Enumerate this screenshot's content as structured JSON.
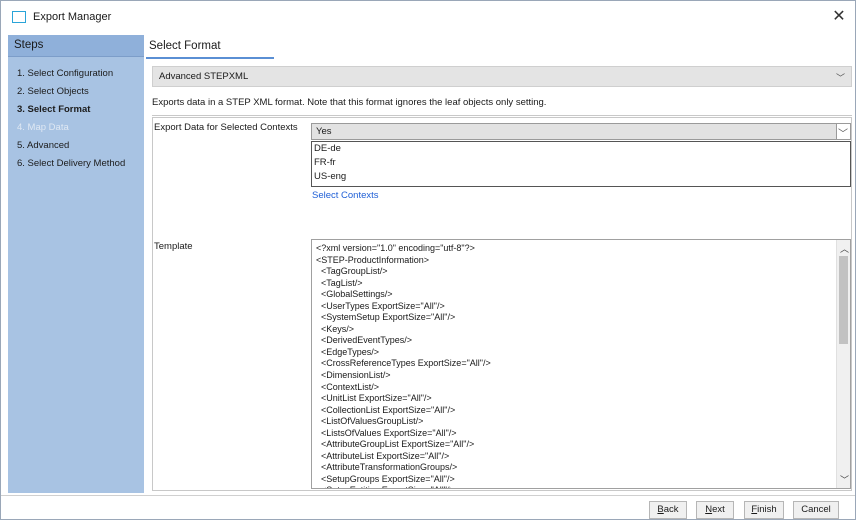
{
  "window": {
    "title": "Export Manager",
    "close_glyph": "✕"
  },
  "sidebar": {
    "header": "Steps",
    "steps": [
      {
        "label": "1. Select Configuration",
        "state": "normal"
      },
      {
        "label": "2. Select Objects",
        "state": "normal"
      },
      {
        "label": "3. Select Format",
        "state": "current"
      },
      {
        "label": "4. Map Data",
        "state": "disabled"
      },
      {
        "label": "5. Advanced",
        "state": "normal"
      },
      {
        "label": "6. Select Delivery Method",
        "state": "normal"
      }
    ]
  },
  "main": {
    "title": "Select Format",
    "format_value": "Advanced STEPXML",
    "description": "Exports data in a STEP XML format. Note that this format ignores the leaf objects only setting.",
    "contexts_label": "Export Data for Selected Contexts",
    "contexts_value": "Yes",
    "contexts": [
      "DE-de",
      "FR-fr",
      "US-eng"
    ],
    "select_contexts_link": "Select Contexts",
    "template_label": "Template",
    "template_lines": [
      "<?xml version=\"1.0\" encoding=\"utf-8\"?>",
      "<STEP-ProductInformation>",
      "  <TagGroupList/>",
      "  <TagList/>",
      "  <GlobalSettings/>",
      "  <UserTypes ExportSize=\"All\"/>",
      "  <SystemSetup ExportSize=\"All\"/>",
      "  <Keys/>",
      "  <DerivedEventTypes/>",
      "  <EdgeTypes/>",
      "  <CrossReferenceTypes ExportSize=\"All\"/>",
      "  <DimensionList/>",
      "  <ContextList/>",
      "  <UnitList ExportSize=\"All\"/>",
      "  <CollectionList ExportSize=\"All\"/>",
      "  <ListOfValuesGroupList/>",
      "  <ListsOfValues ExportSize=\"All\"/>",
      "  <AttributeGroupList ExportSize=\"All\"/>",
      "  <AttributeList ExportSize=\"All\"/>",
      "  <AttributeTransformationGroups/>",
      "  <SetupGroups ExportSize=\"All\"/>",
      "  <SetupEntities ExportSize=\"All\"/>"
    ]
  },
  "footer": {
    "back": {
      "mnemonic": "B",
      "rest": "ack"
    },
    "next": {
      "mnemonic": "N",
      "rest": "ext"
    },
    "finish": {
      "mnemonic": "F",
      "rest": "inish"
    },
    "cancel": "Cancel"
  },
  "colors": {
    "sidebar_bg": "#a8c3e3",
    "sidebar_header_bg": "#8fb0da",
    "link": "#1f5fd6",
    "title_underline": "#5a8fd4"
  }
}
